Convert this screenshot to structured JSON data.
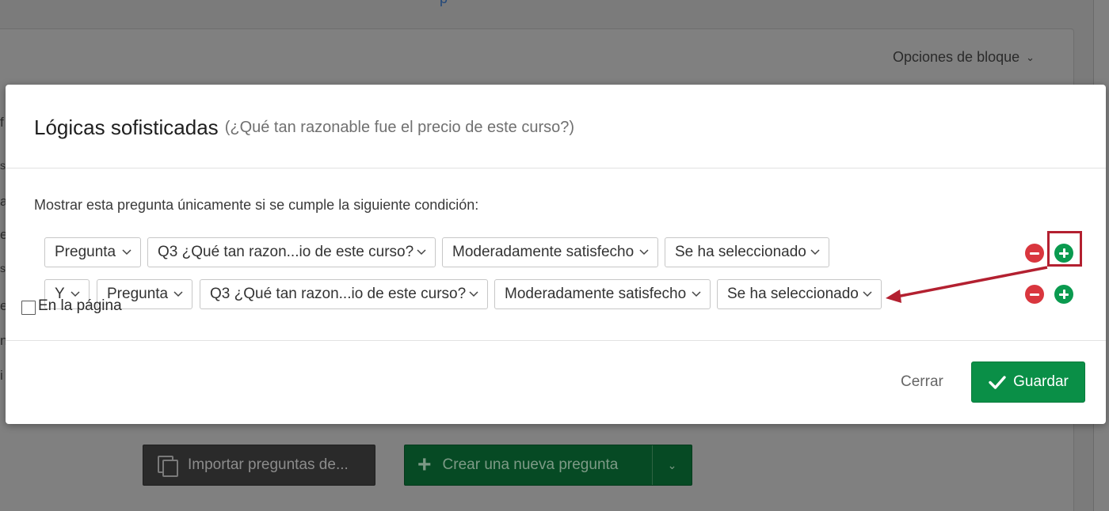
{
  "background": {
    "block_options_label": "Opciones de bloque",
    "import_button_label": "Importar preguntas de...",
    "create_button_label": "Crear una nueva pregunta",
    "left_edge_letters": [
      "f",
      "s",
      "a",
      "e",
      "s",
      "e",
      "n",
      "i"
    ]
  },
  "modal": {
    "title": "Lógicas sofisticadas",
    "subtitle": "(¿Qué tan razonable fue el precio de este curso?)",
    "condition_text": "Mostrar esta pregunta únicamente si se cumple la siguiente condición:",
    "rows": [
      {
        "conjunction": "",
        "type": "Pregunta",
        "question": "Q3 ¿Qué tan razon...io de este curso?",
        "choice": "Moderadamente satisfecho",
        "operator": "Se ha seleccionado"
      },
      {
        "conjunction": "Y",
        "type": "Pregunta",
        "question": "Q3 ¿Qué tan razon...io de este curso?",
        "choice": "Moderadamente satisfecho",
        "operator": "Se ha seleccionado"
      }
    ],
    "on_page_label": "En la página",
    "on_page_checked": false,
    "close_label": "Cerrar",
    "save_label": "Guardar"
  },
  "colors": {
    "accent_green": "#0a8f47",
    "remove_red": "#d9363e",
    "annotation_red": "#b32030"
  },
  "icons": [
    "chevron-down-icon",
    "remove-condition-icon",
    "add-condition-icon",
    "checkmark-icon",
    "plus-icon",
    "import-icon"
  ]
}
